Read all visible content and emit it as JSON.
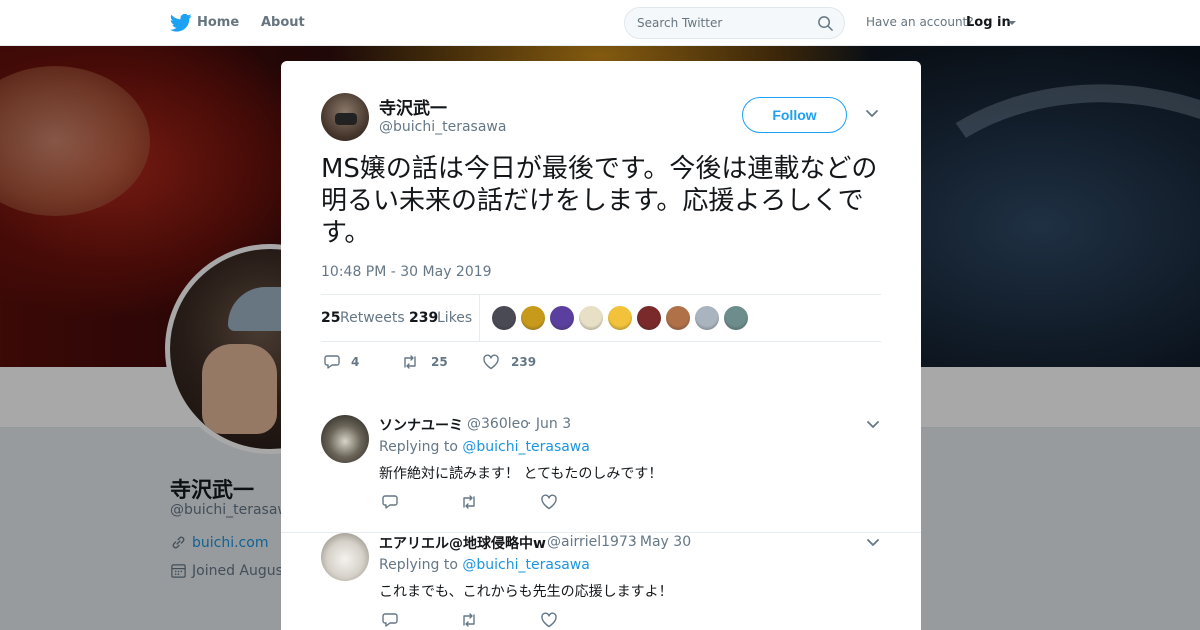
{
  "nav": {
    "home_label": "Home",
    "about_label": "About",
    "search_placeholder": "Search Twitter",
    "account_prompt": "Have an account?",
    "login_label": "Log in"
  },
  "profile": {
    "name": "寺沢武一",
    "handle": "@buichi_terasawa",
    "url": "buichi.com",
    "joined": "Joined August"
  },
  "tweet": {
    "name": "寺沢武一",
    "handle": "@buichi_terasawa",
    "follow_label": "Follow",
    "text": "MS嬢の話は今日が最後です。今後は連載などの明るい未来の話だけをします。応援よろしくです。",
    "timestamp": "10:48 PM - 30 May 2019",
    "retweets_count": "25",
    "retweets_label": "Retweets",
    "likes_count": "239",
    "likes_label": "Likes",
    "likers_colors": [
      "#4a4a55",
      "#c79a1c",
      "#5b3f9e",
      "#e8e0c6",
      "#f2c23a",
      "#7a2a2a",
      "#b07048",
      "#aab4be",
      "#6d8c8c"
    ],
    "actions": {
      "replies": "4",
      "retweets": "25",
      "likes": "239"
    }
  },
  "replies": [
    {
      "name": "ソンナユーミ",
      "handle": "@360leo",
      "date": "· Jun 3",
      "replying_prefix": "Replying to",
      "replying_to": "@buichi_terasawa",
      "text": "新作絶対に読みます！ とてもたのしみです！"
    },
    {
      "name": "エアリエル@地球侵略中w",
      "handle": "@airriel1973",
      "date": "· May 30",
      "replying_prefix": "Replying to",
      "replying_to": "@buichi_terasawa",
      "text": "これまでも、これからも先生の応援しますよ！"
    }
  ],
  "colors": {
    "accent": "#1da1f2",
    "link": "#1b95e0",
    "muted": "#657786",
    "text": "#14171a"
  }
}
